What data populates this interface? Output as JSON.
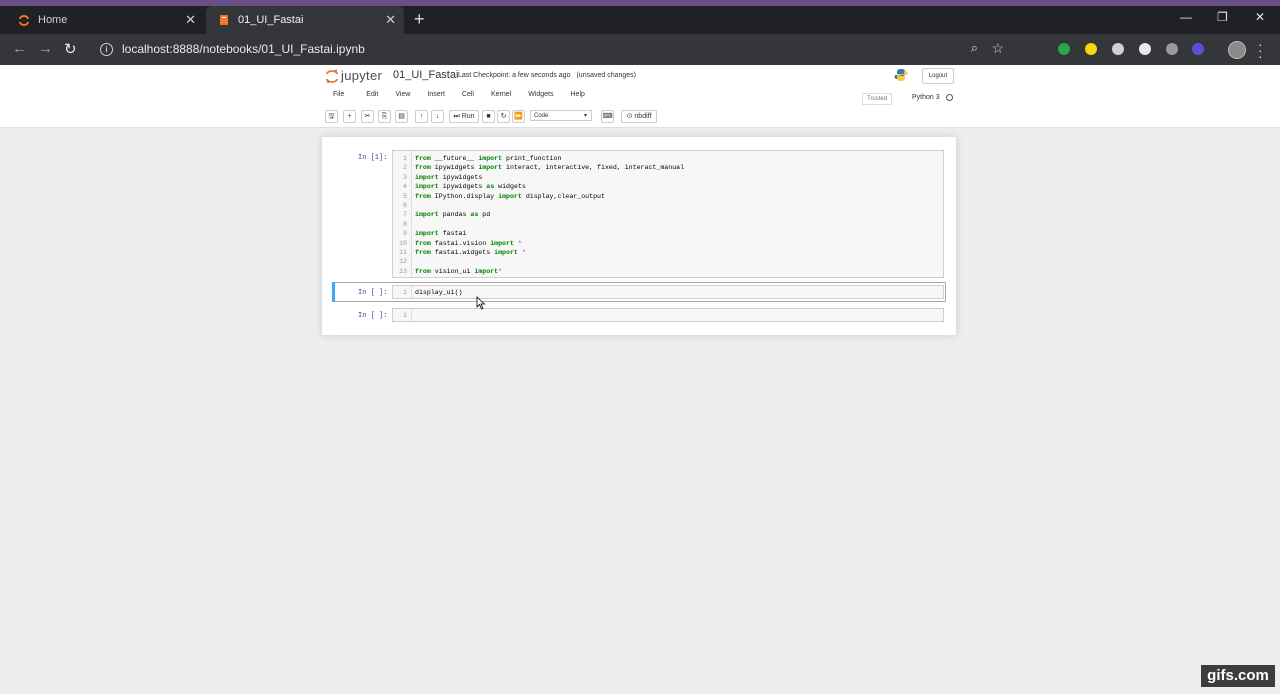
{
  "browser": {
    "tabs": [
      {
        "title": "Home",
        "active": false
      },
      {
        "title": "01_UI_Fastai",
        "active": true
      }
    ],
    "url": "localhost:8888/notebooks/01_UI_Fastai.ipynb",
    "colors": {
      "accent": "#6a4e86"
    }
  },
  "jupyter": {
    "logo_text": "jupyter",
    "notebook_name": "01_UI_Fastai",
    "checkpoint": "Last Checkpoint: a few seconds ago",
    "unsaved": "(unsaved changes)",
    "logout_label": "Logout",
    "menu": [
      "File",
      "Edit",
      "View",
      "Insert",
      "Cell",
      "Kernel",
      "Widgets",
      "Help"
    ],
    "trusted_label": "Trusted",
    "kernel_name": "Python 3",
    "toolbar": {
      "run_label": "Run",
      "cell_type": "Code",
      "nbdiff_label": "nbdiff"
    }
  },
  "cells": [
    {
      "prompt": "In [1]:",
      "lines": [
        {
          "n": "1",
          "text": "from __future__ import print_function"
        },
        {
          "n": "2",
          "text": "from ipywidgets import interact, interactive, fixed, interact_manual"
        },
        {
          "n": "3",
          "text": "import ipywidgets"
        },
        {
          "n": "4",
          "text": "import ipywidgets as widgets"
        },
        {
          "n": "5",
          "text": "from IPython.display import display,clear_output"
        },
        {
          "n": "6",
          "text": ""
        },
        {
          "n": "7",
          "text": "import pandas as pd"
        },
        {
          "n": "8",
          "text": ""
        },
        {
          "n": "9",
          "text": "import fastai"
        },
        {
          "n": "10",
          "text": "from fastai.vision import *"
        },
        {
          "n": "11",
          "text": "from fastai.widgets import *"
        },
        {
          "n": "12",
          "text": ""
        },
        {
          "n": "13",
          "text": "from vision_ui import*"
        }
      ]
    },
    {
      "prompt": "In [ ]:",
      "lines": [
        {
          "n": "1",
          "text": "display_ui()"
        }
      ]
    },
    {
      "prompt": "In [ ]:",
      "lines": [
        {
          "n": "1",
          "text": ""
        }
      ]
    }
  ],
  "watermark": "gifs.com"
}
